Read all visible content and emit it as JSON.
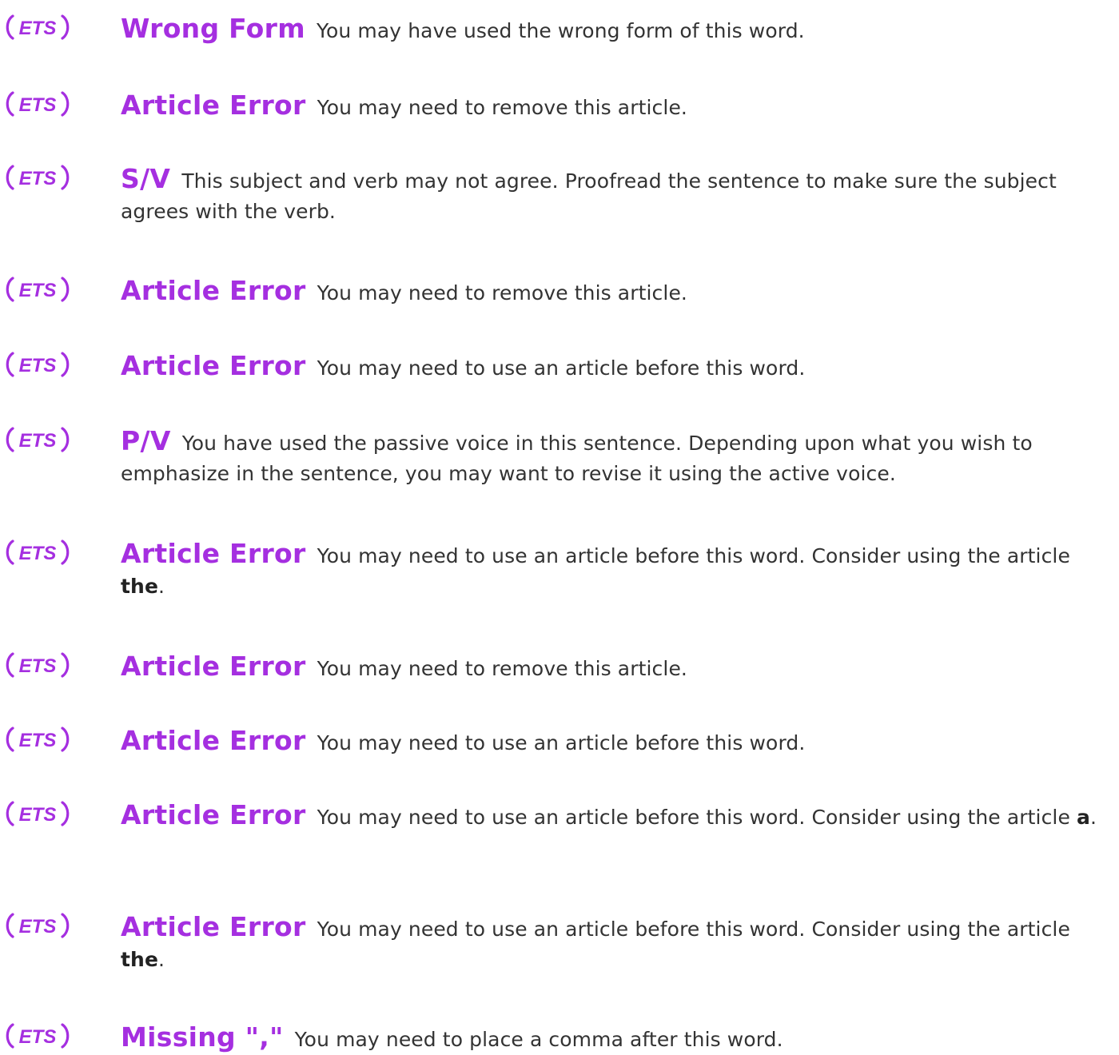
{
  "logo_text": "ETS",
  "accent_color": "#a52fe0",
  "items": [
    {
      "title": "Wrong Form",
      "message": "You may have used the wrong form of this word.",
      "suggestion": "",
      "suffix": ""
    },
    {
      "title": "Article Error",
      "message": "You may need to remove this article.",
      "suggestion": "",
      "suffix": ""
    },
    {
      "title": "S/V",
      "message": "This subject and verb may not agree. Proofread the sentence to make sure the subject agrees with the verb.",
      "suggestion": "",
      "suffix": ""
    },
    {
      "title": "Article Error",
      "message": "You may need to remove this article.",
      "suggestion": "",
      "suffix": ""
    },
    {
      "title": "Article Error",
      "message": "You may need to use an article before this word.",
      "suggestion": "",
      "suffix": ""
    },
    {
      "title": "P/V",
      "message": "You have used the passive voice in this sentence. Depending upon what you wish to emphasize in the sentence, you may want to revise it using the active voice.",
      "suggestion": "",
      "suffix": ""
    },
    {
      "title": "Article Error",
      "message": "You may need to use an article before this word. Consider using the article",
      "suggestion": "the",
      "suffix": "."
    },
    {
      "title": "Article Error",
      "message": "You may need to remove this article.",
      "suggestion": "",
      "suffix": ""
    },
    {
      "title": "Article Error",
      "message": "You may need to use an article before this word.",
      "suggestion": "",
      "suffix": ""
    },
    {
      "title": "Article Error",
      "message": "You may need to use an article before this word. Consider using the article",
      "suggestion": "a",
      "suffix": "."
    },
    {
      "title": "Article Error",
      "message": "You may need to use an article before this word. Consider using the article",
      "suggestion": "the",
      "suffix": "."
    },
    {
      "title": "Missing \",\"",
      "message": "You may need to place a comma after this word.",
      "suggestion": "",
      "suffix": ""
    }
  ]
}
